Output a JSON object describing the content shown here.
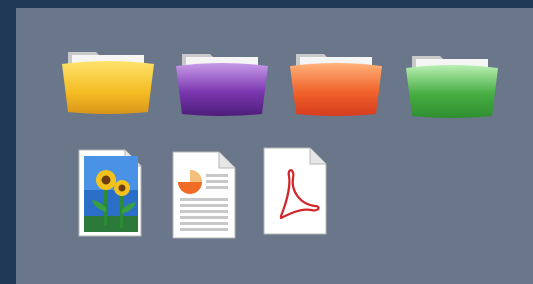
{
  "desktop": {
    "background_color": "#1f3957",
    "panel_color": "#6a7689",
    "folders": [
      {
        "name": "yellow-folder",
        "color": "#f2b51f",
        "icon": "folder-icon"
      },
      {
        "name": "purple-folder",
        "color": "#6a2e96",
        "icon": "folder-icon"
      },
      {
        "name": "orange-folder",
        "color": "#ef5a22",
        "icon": "folder-icon"
      },
      {
        "name": "green-folder",
        "color": "#3f9e3a",
        "icon": "folder-icon"
      }
    ],
    "files": [
      {
        "name": "image-file",
        "icon": "sunflower-image-icon"
      },
      {
        "name": "presentation-file",
        "icon": "pie-chart-document-icon"
      },
      {
        "name": "pdf-file",
        "icon": "acrobat-pdf-icon"
      }
    ]
  }
}
